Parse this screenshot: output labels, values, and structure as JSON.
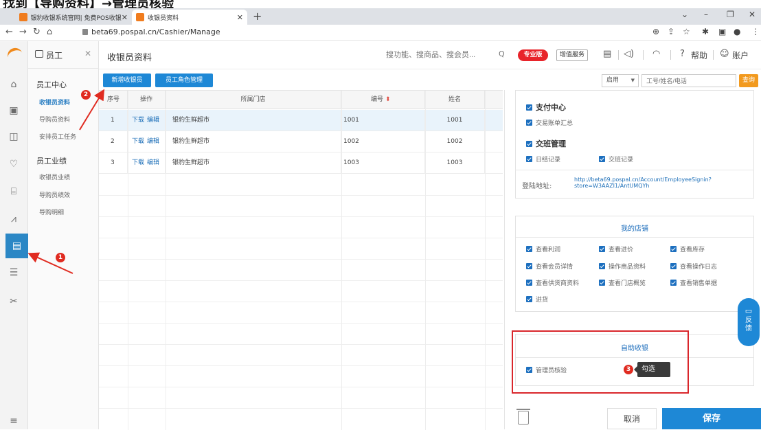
{
  "caption": "找到【导购资料】→管理员核验",
  "browser": {
    "tabs": [
      {
        "label": "银豹收银系统官网| 免费POS收银"
      },
      {
        "label": "收银员资料"
      }
    ],
    "url": "beta69.pospal.cn/Cashier/Manage"
  },
  "nav_panel": {
    "title": "员工",
    "sections": [
      {
        "label": "员工中心",
        "items": [
          "收银员资料",
          "导购员资料",
          "安排员工任务"
        ]
      },
      {
        "label": "员工业绩",
        "items": [
          "收银员业绩",
          "导购员绩效",
          "导购明细"
        ]
      }
    ]
  },
  "header": {
    "title": "收银员资料",
    "search_placeholder": "搜功能、搜商品、搜会员...",
    "pro_badge": "专业版",
    "vas_label": "增值服务",
    "help_label": "帮助",
    "account_label": "账户"
  },
  "toolbar": {
    "add_cashier": "新增收银员",
    "role_manage": "员工角色管理",
    "status_value": "启用",
    "emp_search_placeholder": "工号/姓名/电话",
    "query_label": "查询"
  },
  "table": {
    "columns": [
      "序号",
      "操作",
      "所属门店",
      "编号",
      "姓名"
    ],
    "rows": [
      {
        "idx": "1",
        "download": "下载",
        "edit": "编辑",
        "store": "银豹生鲜超市",
        "code": "1001",
        "name": "1001"
      },
      {
        "idx": "2",
        "download": "下载",
        "edit": "编辑",
        "store": "银豹生鲜超市",
        "code": "1002",
        "name": "1002"
      },
      {
        "idx": "3",
        "download": "下载",
        "edit": "编辑",
        "store": "银豹生鲜超市",
        "code": "1003",
        "name": "1003"
      }
    ]
  },
  "permissions": {
    "pay_center": "支付中心",
    "pay_summary": "交易账单汇总",
    "shift_mgmt": "交班管理",
    "daily_log": "日结记录",
    "shift_log": "交班记录",
    "login_label": "登陆地址:",
    "login_url_1": "http://beta69.pospal.cn/Account/EmployeeSignin?",
    "login_url_2": "store=W3AAZI1/AntUMQYh",
    "my_store_title": "我的店铺",
    "my_store_items": [
      "查看利润",
      "查看进价",
      "查看库存",
      "查看会员详情",
      "操作商品资料",
      "查看操作日志",
      "查看供货商资料",
      "查看门店概览",
      "查看销售单据",
      "进货"
    ],
    "self_checkout_title": "自助收银",
    "admin_verify": "管理员核验"
  },
  "feedback_label": "反馈",
  "cancel_label": "取消",
  "save_label": "保存",
  "annotations": {
    "badge1": "1",
    "badge2": "2",
    "badge3": "3",
    "tooltip": "勾选"
  }
}
